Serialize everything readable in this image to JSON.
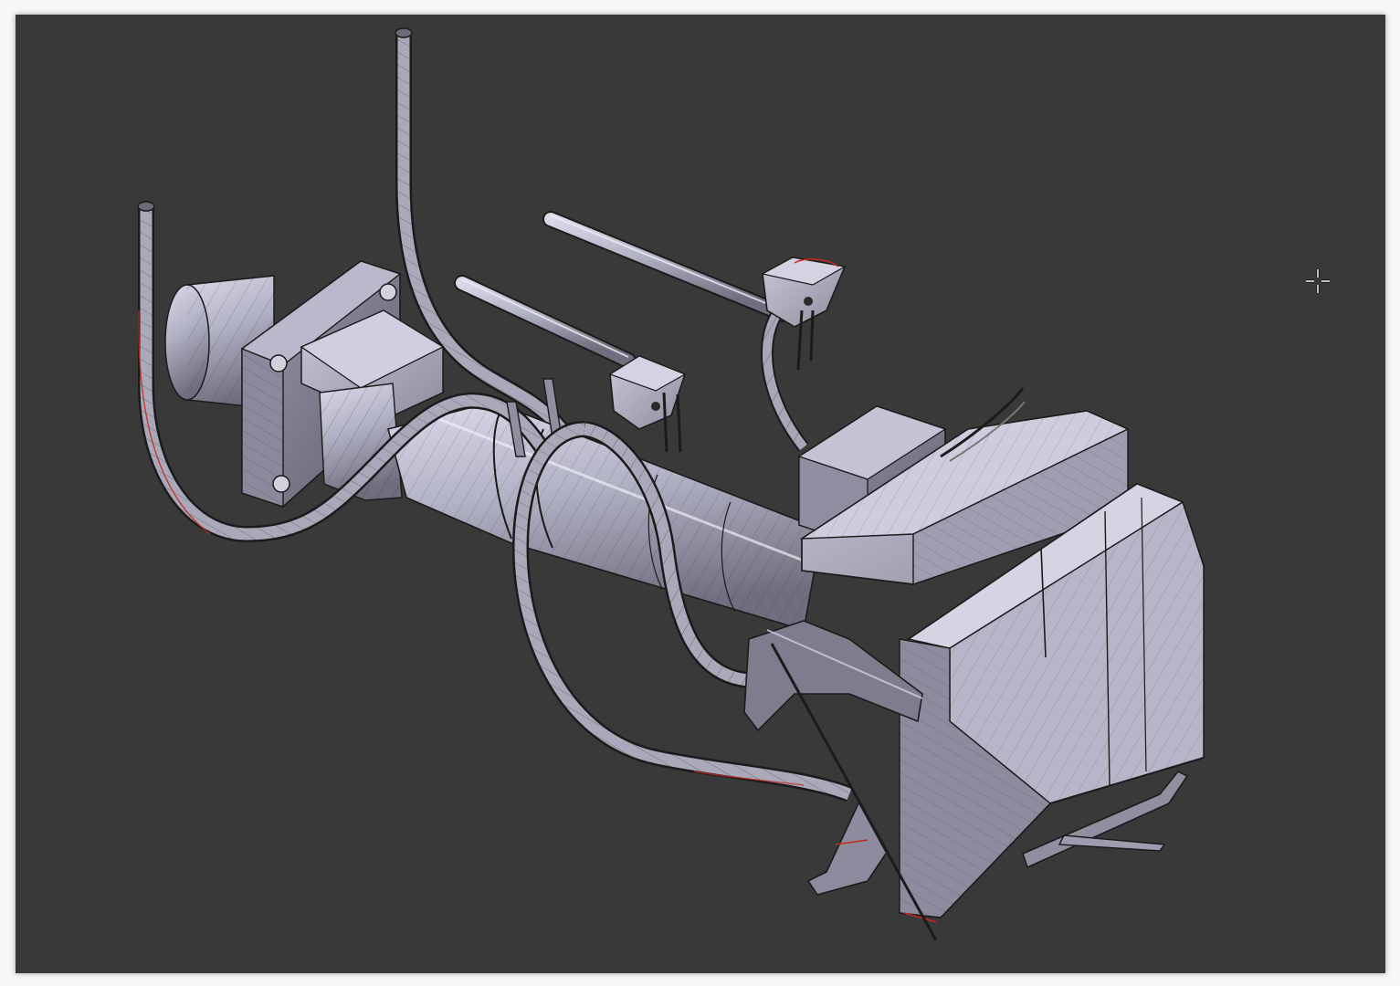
{
  "viewport": {
    "background": "#393939",
    "border_color": "#f7f7f7"
  },
  "model": {
    "name": "",
    "display_mode": "wireframe-over-solid",
    "mesh_color": "#b4b4c8",
    "edge_color": "#1a1a1a",
    "seam_color": "#c8281e",
    "parts": [
      "mounting-flange",
      "flange-cylinder",
      "main-boom-tube",
      "hose-left",
      "hose-center-tall",
      "hose-loop",
      "upper-rod",
      "lower-rod",
      "clamp-upper",
      "clamp-lower",
      "nozzle-head-box",
      "head-hood",
      "head-lower-housing",
      "bottom-bracket",
      "bottom-skid"
    ]
  },
  "cursor": {
    "icon": "crosshair-cursor-icon",
    "color": "#ffffff"
  }
}
